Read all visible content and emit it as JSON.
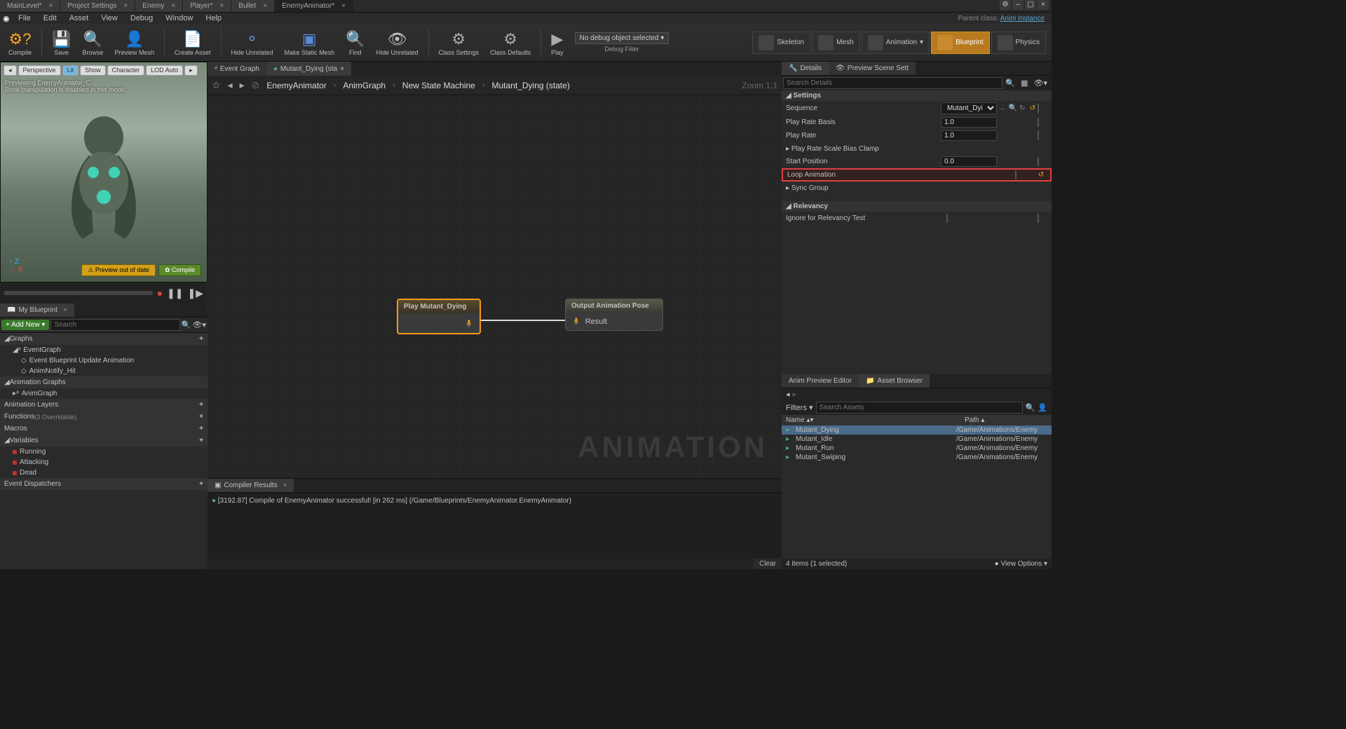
{
  "window": {
    "tabs": [
      {
        "label": "MainLevel*",
        "icon": "level"
      },
      {
        "label": "Project Settings",
        "icon": "gear"
      },
      {
        "label": "Enemy",
        "icon": "pawn"
      },
      {
        "label": "Player*",
        "icon": "pawn"
      },
      {
        "label": "Bullet",
        "icon": "dot"
      },
      {
        "label": "EnemyAnimator*",
        "icon": "anim",
        "active": true
      }
    ],
    "parent_class_label": "Parent class:",
    "parent_class_value": "Anim Instance"
  },
  "menu": [
    "File",
    "Edit",
    "Asset",
    "View",
    "Debug",
    "Window",
    "Help"
  ],
  "toolbar": {
    "items": [
      "Compile",
      "Save",
      "Browse",
      "Preview Mesh",
      "Create Asset",
      "Hide Unrelated",
      "Make Static Mesh",
      "Find",
      "Hide Unrelated",
      "Class Settings",
      "Class Defaults",
      "Play"
    ],
    "debug_selected": "No debug object selected ▾",
    "debug_filter": "Debug Filter",
    "modes": [
      "Skeleton",
      "Mesh",
      "Animation",
      "Blueprint",
      "Physics"
    ],
    "mode_active": "Blueprint"
  },
  "viewport": {
    "buttons": [
      "◂",
      "Perspective",
      "Lit",
      "Show",
      "Character",
      "LOD Auto",
      "▸"
    ],
    "hint": "Previewing EnemyAnimator_C.\nBone manipulation is disabled in this mode.",
    "badge_warn": "⚠ Preview out of date",
    "badge_ok": "✿ Compile"
  },
  "my_blueprint": {
    "title": "My Blueprint",
    "add_new": "+ Add New ▾",
    "search_placeholder": "Search",
    "sections": {
      "graphs": {
        "label": "Graphs",
        "items": [
          "EventGraph",
          "Event Blueprint Update Animation",
          "AnimNotify_Hit"
        ]
      },
      "anim_graphs": {
        "label": "Animation Graphs",
        "items": [
          "AnimGraph"
        ]
      },
      "anim_layers": {
        "label": "Animation Layers"
      },
      "functions": {
        "label": "Functions",
        "sub": "(3 Overridable)"
      },
      "macros": {
        "label": "Macros"
      },
      "variables": {
        "label": "Variables",
        "items": [
          "Running",
          "Attacking",
          "Dead"
        ]
      },
      "dispatchers": {
        "label": "Event Dispatchers"
      }
    }
  },
  "graph": {
    "tab1": "Event Graph",
    "tab2": "Mutant_Dying (sta",
    "breadcrumb": [
      "EnemyAnimator",
      "AnimGraph",
      "New State Machine",
      "Mutant_Dying (state)"
    ],
    "zoom": "Zoom 1:1",
    "node_play": "Play Mutant_Dying",
    "node_out_title": "Output Animation Pose",
    "node_out_pin": "Result",
    "watermark": "ANIMATION"
  },
  "compiler": {
    "title": "Compiler Results",
    "message": "[3192.87] Compile of EnemyAnimator successful! [in 262 ms] (/Game/Blueprints/EnemyAnimator.EnemyAnimator)",
    "clear": "Clear"
  },
  "details": {
    "tab1": "Details",
    "tab2": "Preview Scene Sett",
    "search_placeholder": "Search Details",
    "section_settings": "Settings",
    "section_relevancy": "Relevancy",
    "rows": {
      "sequence": {
        "k": "Sequence",
        "v": "Mutant_Dying"
      },
      "play_rate_basis": {
        "k": "Play Rate Basis",
        "v": "1.0"
      },
      "play_rate": {
        "k": "Play Rate",
        "v": "1.0"
      },
      "play_rate_clamp": {
        "k": "Play Rate Scale Bias Clamp"
      },
      "start_position": {
        "k": "Start Position",
        "v": "0.0"
      },
      "loop_animation": {
        "k": "Loop Animation"
      },
      "sync_group": {
        "k": "Sync Group"
      },
      "ignore_relevancy": {
        "k": "Ignore for Relevancy Test"
      }
    }
  },
  "asset_browser": {
    "tab1": "Anim Preview Editor",
    "tab2": "Asset Browser",
    "filters": "Filters ▾",
    "search_placeholder": "Search Assets",
    "col_name": "Name",
    "col_path": "Path",
    "rows": [
      {
        "name": "Mutant_Dying",
        "path": "/Game/Animations/Enemy",
        "selected": true
      },
      {
        "name": "Mutant_Idle",
        "path": "/Game/Animations/Enemy"
      },
      {
        "name": "Mutant_Run",
        "path": "/Game/Animations/Enemy"
      },
      {
        "name": "Mutant_Swiping",
        "path": "/Game/Animations/Enemy"
      }
    ],
    "footer_items": "4 items (1 selected)",
    "footer_view": "● View Options ▾"
  }
}
